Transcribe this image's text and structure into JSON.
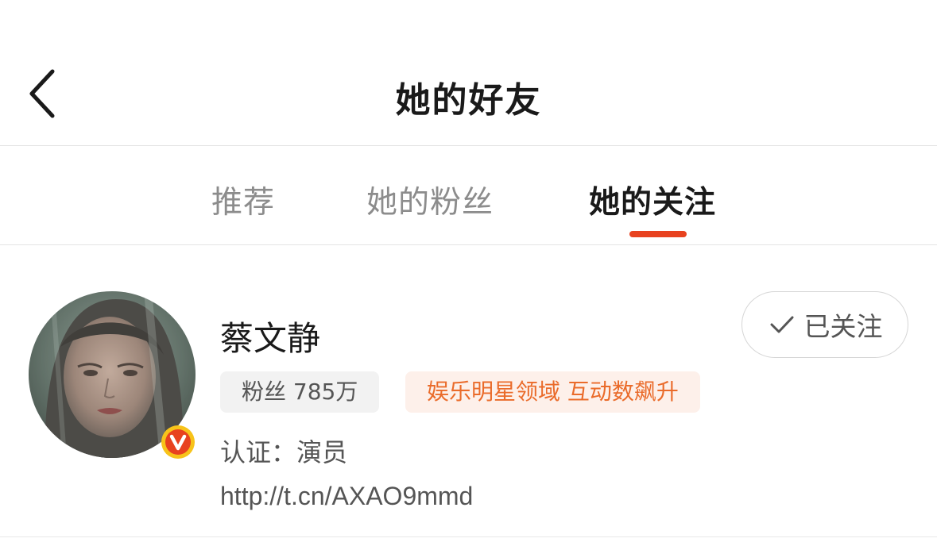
{
  "header": {
    "title": "她的好友",
    "back_icon": "chevron-left-icon"
  },
  "tabs": [
    {
      "label": "推荐",
      "active": false
    },
    {
      "label": "她的粉丝",
      "active": false
    },
    {
      "label": "她的关注",
      "active": true
    }
  ],
  "colors": {
    "accent": "#e8421f",
    "tag_orange": "#ea6b2a",
    "tag_orange_bg": "#fdf0ea",
    "badge_red": "#e8421f",
    "badge_ring": "#f7c31a"
  },
  "user": {
    "name": "蔡文静",
    "fans": "粉丝 785万",
    "field_tag": "娱乐明星领域 互动数飙升",
    "verification": "认证：演员",
    "link": "http://t.cn/AXAO9mmd",
    "verified_badge": "V",
    "follow_button": {
      "label": "已关注",
      "icon": "check-icon"
    }
  }
}
